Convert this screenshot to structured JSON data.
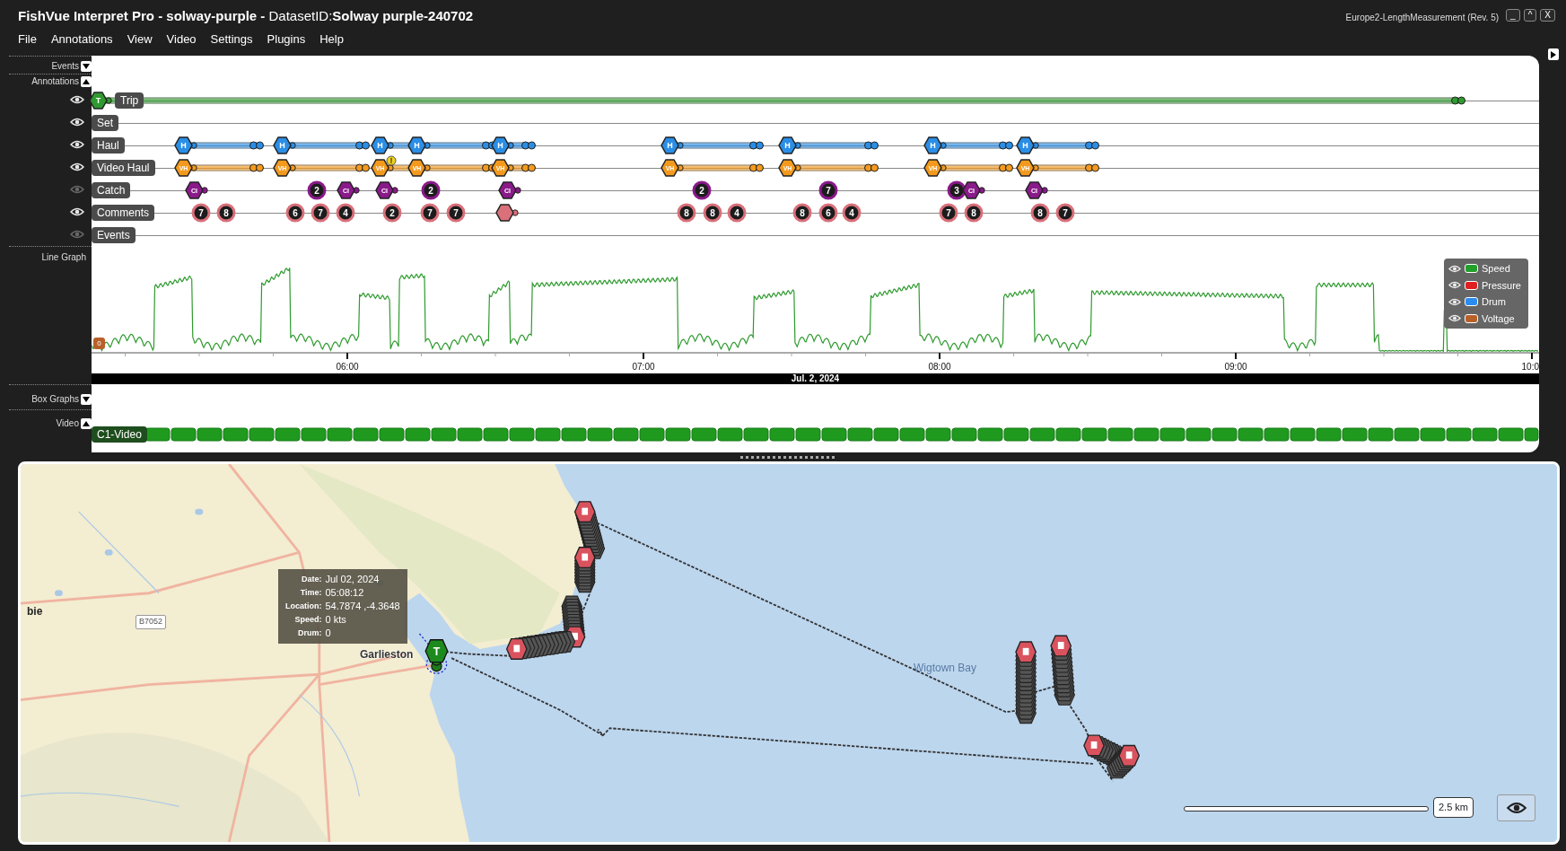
{
  "window": {
    "title": "**FishVue Interpret Pro - solway-purple -** DatasetID:**Solway purple-240702**",
    "profile": "Europe2-LengthMeasurement (Rev. 5)",
    "controls": [
      "_",
      "^",
      "X"
    ]
  },
  "menu": [
    "File",
    "Annotations",
    "View",
    "Video",
    "Settings",
    "Plugins",
    "Help"
  ],
  "sections": [
    {
      "label": "Events",
      "expanded": false
    },
    {
      "label": "Annotations",
      "expanded": true
    },
    {
      "label": "Line Graph"
    },
    {
      "label": "Box Graphs",
      "expanded": false
    },
    {
      "label": "Video",
      "expanded": true
    }
  ],
  "annotations": {
    "rows": [
      {
        "label": "Trip",
        "visible": true,
        "color": "#2f9a2f",
        "items": [
          {
            "kind": "span",
            "text": "T"
          }
        ]
      },
      {
        "label": "Set",
        "visible": true
      },
      {
        "label": "Haul",
        "visible": true,
        "color": "#2b8ee6",
        "items": [
          {
            "kind": "span",
            "text": "H"
          },
          {
            "kind": "span",
            "text": "H"
          },
          {
            "kind": "span",
            "text": "H"
          },
          {
            "kind": "span",
            "text": "H"
          },
          {
            "kind": "span",
            "text": "H"
          },
          {
            "kind": "span",
            "text": "H"
          },
          {
            "kind": "span",
            "text": "H"
          },
          {
            "kind": "span",
            "text": "H"
          },
          {
            "kind": "span",
            "text": "H"
          }
        ]
      },
      {
        "label": "Video Haul",
        "visible": true,
        "color": "#f39a1e",
        "items": [
          {
            "kind": "span",
            "text": "VH"
          },
          {
            "kind": "span",
            "text": "VH"
          },
          {
            "kind": "span",
            "text": "VH"
          },
          {
            "kind": "span",
            "text": "VH"
          },
          {
            "kind": "span",
            "text": "VH"
          },
          {
            "kind": "span",
            "text": "VH"
          },
          {
            "kind": "span",
            "text": "VH"
          },
          {
            "kind": "span",
            "text": "VH"
          },
          {
            "kind": "span",
            "text": "VH"
          },
          {
            "kind": "warning",
            "text": "!"
          }
        ]
      },
      {
        "label": "Catch",
        "visible": false,
        "color": "#8a1a8a",
        "items": [
          {
            "kind": "marker",
            "text": "CI"
          },
          {
            "kind": "count",
            "text": "2"
          },
          {
            "kind": "marker",
            "text": "CI"
          },
          {
            "kind": "marker",
            "text": "CI"
          },
          {
            "kind": "count",
            "text": "2"
          },
          {
            "kind": "marker",
            "text": "CI"
          },
          {
            "kind": "count",
            "text": "2"
          },
          {
            "kind": "count",
            "text": "7"
          },
          {
            "kind": "count",
            "text": "3"
          },
          {
            "kind": "marker",
            "text": "CI"
          },
          {
            "kind": "marker",
            "text": "CI"
          }
        ]
      },
      {
        "label": "Comments",
        "visible": true,
        "color": "#d9707a",
        "items": [
          {
            "kind": "count",
            "text": "7"
          },
          {
            "kind": "count",
            "text": "8"
          },
          {
            "kind": "count",
            "text": "6"
          },
          {
            "kind": "count",
            "text": "7"
          },
          {
            "kind": "count",
            "text": "4"
          },
          {
            "kind": "count",
            "text": "2"
          },
          {
            "kind": "count",
            "text": "7"
          },
          {
            "kind": "count",
            "text": "7"
          },
          {
            "kind": "marker"
          },
          {
            "kind": "count",
            "text": "8"
          },
          {
            "kind": "count",
            "text": "8"
          },
          {
            "kind": "count",
            "text": "4"
          },
          {
            "kind": "count",
            "text": "8"
          },
          {
            "kind": "count",
            "text": "6"
          },
          {
            "kind": "count",
            "text": "4"
          },
          {
            "kind": "count",
            "text": "7"
          },
          {
            "kind": "count",
            "text": "8"
          },
          {
            "kind": "count",
            "text": "8"
          },
          {
            "kind": "count",
            "text": "7"
          }
        ]
      },
      {
        "label": "Events",
        "visible": false
      }
    ]
  },
  "line_graph": {
    "ticks": [
      "06:00",
      "07:00",
      "08:00",
      "09:00",
      "10:0"
    ],
    "date": "Jul. 2, 2024",
    "marker_text": "0",
    "legend": [
      {
        "name": "Speed",
        "color": "#22a02a"
      },
      {
        "name": "Pressure",
        "color": "#e02020"
      },
      {
        "name": "Drum",
        "color": "#2a8cf0"
      },
      {
        "name": "Voltage",
        "color": "#b8602a"
      }
    ]
  },
  "video": {
    "tracks": [
      {
        "label": "C1-Video"
      }
    ]
  },
  "map": {
    "place_labels": [
      "bie",
      "Garlieston",
      "Wigtown Bay"
    ],
    "road_label": "B7052",
    "trip_marker": "T",
    "tooltip": [
      {
        "label": "Date:",
        "value": "Jul 02, 2024"
      },
      {
        "label": "Time:",
        "value": "05:08:12"
      },
      {
        "label": "Location:",
        "value": "54.7874 ,-4.3648"
      },
      {
        "label": "Speed:",
        "value": "0 kts"
      },
      {
        "label": "Drum:",
        "value": "0"
      }
    ],
    "scale": "2.5 km"
  }
}
